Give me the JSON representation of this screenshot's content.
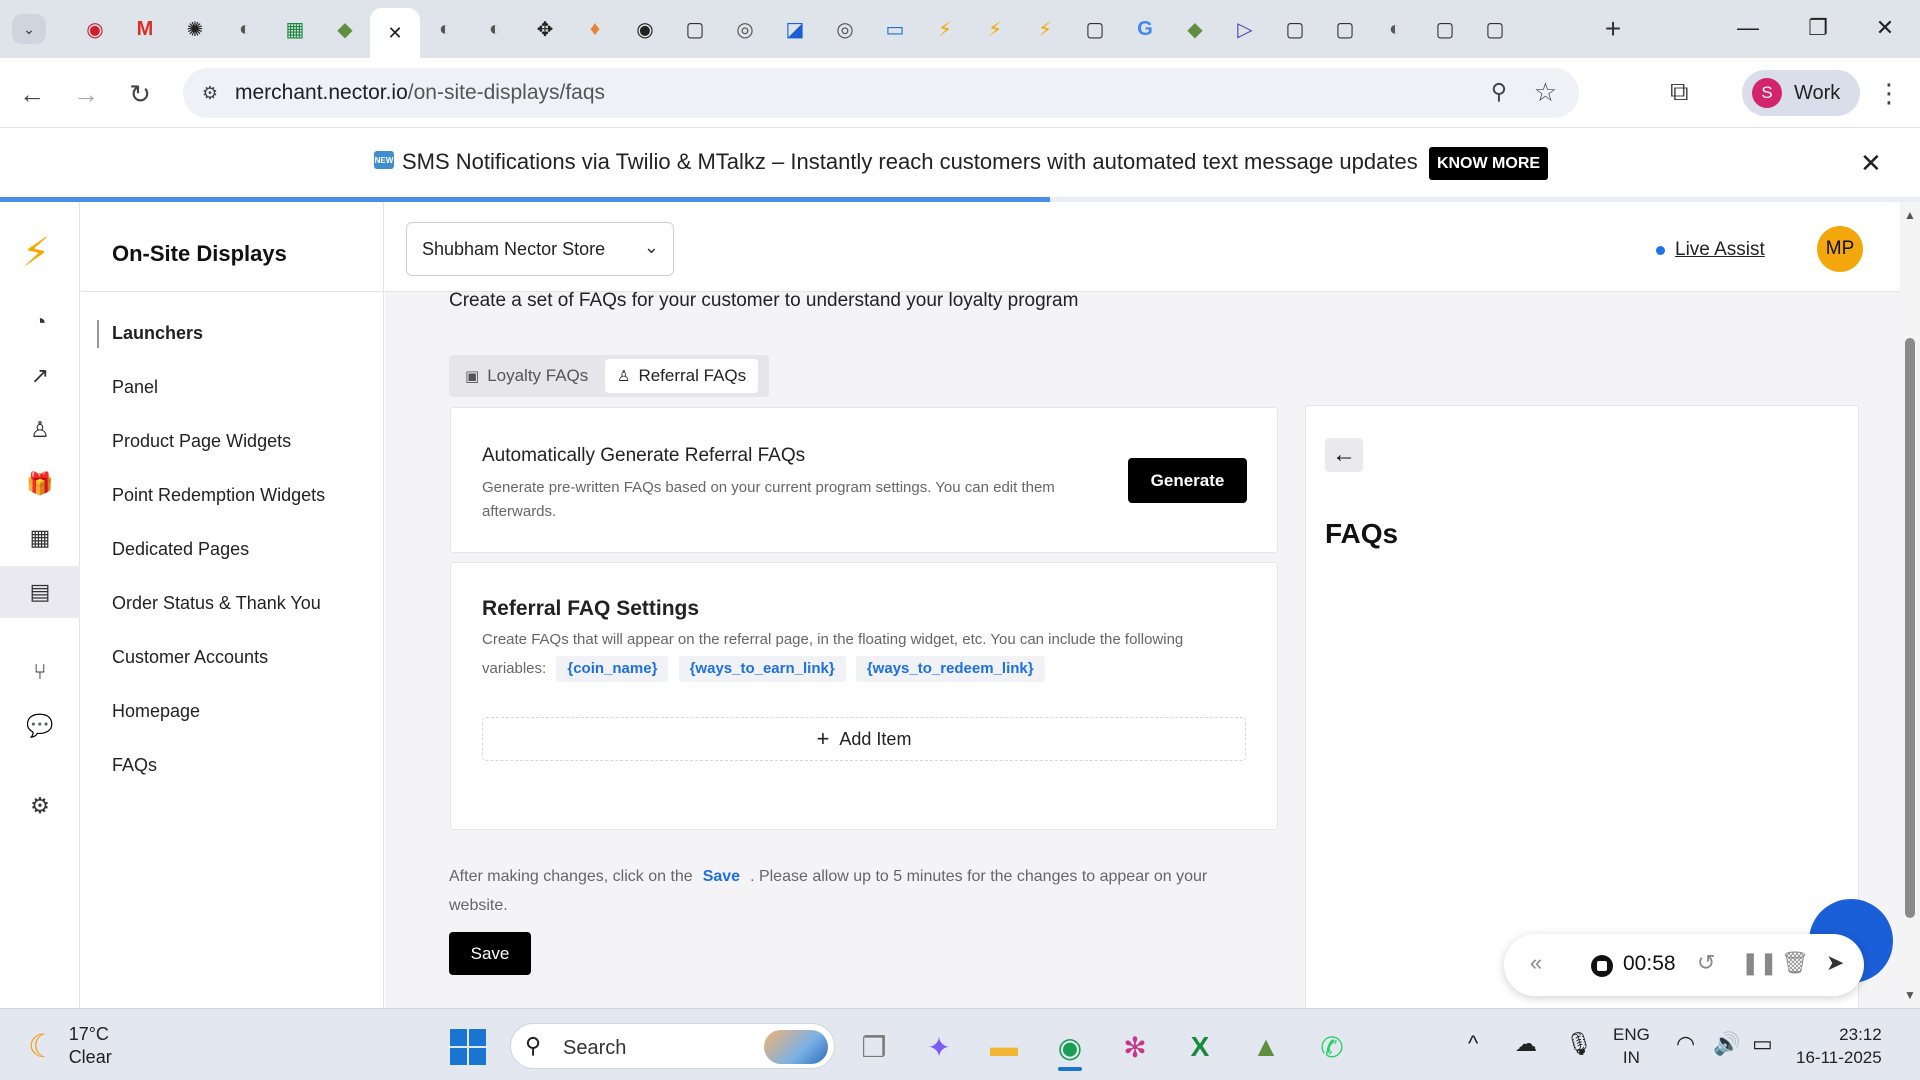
{
  "browser": {
    "tab_icons": [
      {
        "name": "record-tab-icon",
        "glyph": "◉",
        "color": "#d01f2e"
      },
      {
        "name": "gmail-tab-icon",
        "glyph": "M",
        "color": "#d93025"
      },
      {
        "name": "openai-tab-icon",
        "glyph": "✺",
        "color": "#222222"
      },
      {
        "name": "globe-tab-icon",
        "glyph": "◐",
        "color": "#555555"
      },
      {
        "name": "sheets-tab-icon",
        "glyph": "▦",
        "color": "#1b8a3e"
      },
      {
        "name": "shopify-tab-icon",
        "glyph": "◆",
        "color": "#5e8e3e"
      },
      {
        "name": "close-active-tab-icon",
        "glyph": "✕",
        "color": "#222222",
        "active": true
      },
      {
        "name": "globe-tab-icon",
        "glyph": "◐",
        "color": "#555555"
      },
      {
        "name": "globe-tab-icon",
        "glyph": "◐",
        "color": "#555555"
      },
      {
        "name": "figma-tab-icon",
        "glyph": "✥",
        "color": "#222222"
      },
      {
        "name": "drop-tab-icon",
        "glyph": "♦",
        "color": "#e8813a"
      },
      {
        "name": "app-tab-icon",
        "glyph": "◉",
        "color": "#222222"
      },
      {
        "name": "page-tab-icon",
        "glyph": "▢",
        "color": "#333333"
      },
      {
        "name": "app-tab-icon",
        "glyph": "◎",
        "color": "#555555"
      },
      {
        "name": "app-tab-icon",
        "glyph": "◪",
        "color": "#1a5fd8"
      },
      {
        "name": "app-tab-icon",
        "glyph": "◎",
        "color": "#555555"
      },
      {
        "name": "chat-tab-icon",
        "glyph": "▭",
        "color": "#1a74d2"
      },
      {
        "name": "bolt-tab-icon",
        "glyph": "⚡",
        "color": "#f5a800"
      },
      {
        "name": "bolt-tab-icon",
        "glyph": "⚡",
        "color": "#f5a800"
      },
      {
        "name": "bolt-tab-icon",
        "glyph": "⚡",
        "color": "#f5a800"
      },
      {
        "name": "page-tab-icon",
        "glyph": "▢",
        "color": "#333333"
      },
      {
        "name": "google-tab-icon",
        "glyph": "G",
        "color": "#4285f4"
      },
      {
        "name": "shopify-tab-icon",
        "glyph": "◆",
        "color": "#5e8e3e"
      },
      {
        "name": "play-tab-icon",
        "glyph": "▷",
        "color": "#4a3fb5"
      },
      {
        "name": "page-tab-icon",
        "glyph": "▢",
        "color": "#333333"
      },
      {
        "name": "page-tab-icon",
        "glyph": "▢",
        "color": "#333333"
      },
      {
        "name": "globe-tab-icon",
        "glyph": "◐",
        "color": "#555555"
      },
      {
        "name": "page-tab-icon",
        "glyph": "▢",
        "color": "#333333"
      },
      {
        "name": "page-tab-icon",
        "glyph": "▢",
        "color": "#333333"
      }
    ],
    "url_host": "merchant.nector.io",
    "url_path": "/on-site-displays/faqs",
    "profile_initial": "S",
    "profile_name": "Work"
  },
  "banner": {
    "icon_text": "NEW",
    "text": "SMS Notifications via Twilio & MTalkz – Instantly reach customers with automated text message updates",
    "button": "KNOW MORE",
    "load_progress": 0.547
  },
  "sidebar": {
    "title": "On-Site Displays",
    "items": [
      {
        "label": "Launchers",
        "active": true
      },
      {
        "label": "Panel"
      },
      {
        "label": "Product Page Widgets"
      },
      {
        "label": "Point Redemption Widgets"
      },
      {
        "label": "Dedicated Pages"
      },
      {
        "label": "Order Status & Thank You"
      },
      {
        "label": "Customer Accounts"
      },
      {
        "label": "Homepage"
      },
      {
        "label": "FAQs"
      }
    ]
  },
  "header": {
    "store": "Shubham Nector Store",
    "live_assist": "Live Assist",
    "avatar": "MP"
  },
  "main": {
    "intro": "Create a set of FAQs for your customer to understand your loyalty program",
    "tabs": [
      {
        "label": "Loyalty FAQs",
        "active": false
      },
      {
        "label": "Referral FAQs",
        "active": true
      }
    ],
    "auto": {
      "title": "Automatically Generate Referral FAQs",
      "desc": "Generate pre-written FAQs based on your current program settings. You can edit them afterwards.",
      "button": "Generate"
    },
    "settings": {
      "title": "Referral FAQ Settings",
      "desc": "Create FAQs that will appear on the referral page, in the floating widget, etc. You can include the following variables:",
      "variables": [
        "{coin_name}",
        "{ways_to_earn_link}",
        "{ways_to_redeem_link}"
      ],
      "add_item": "Add Item"
    },
    "note_before": "After making changes, click on the",
    "note_link": "Save",
    "note_after": ". Please allow up to 5 minutes for the changes to appear on your website.",
    "save": "Save"
  },
  "preview": {
    "heading": "FAQs"
  },
  "recorder": {
    "time": "00:58"
  },
  "taskbar": {
    "temp": "17°C",
    "condition": "Clear",
    "search": "Search",
    "lang_top": "ENG",
    "lang_bottom": "IN",
    "time": "23:12",
    "date": "16-11-2025"
  }
}
